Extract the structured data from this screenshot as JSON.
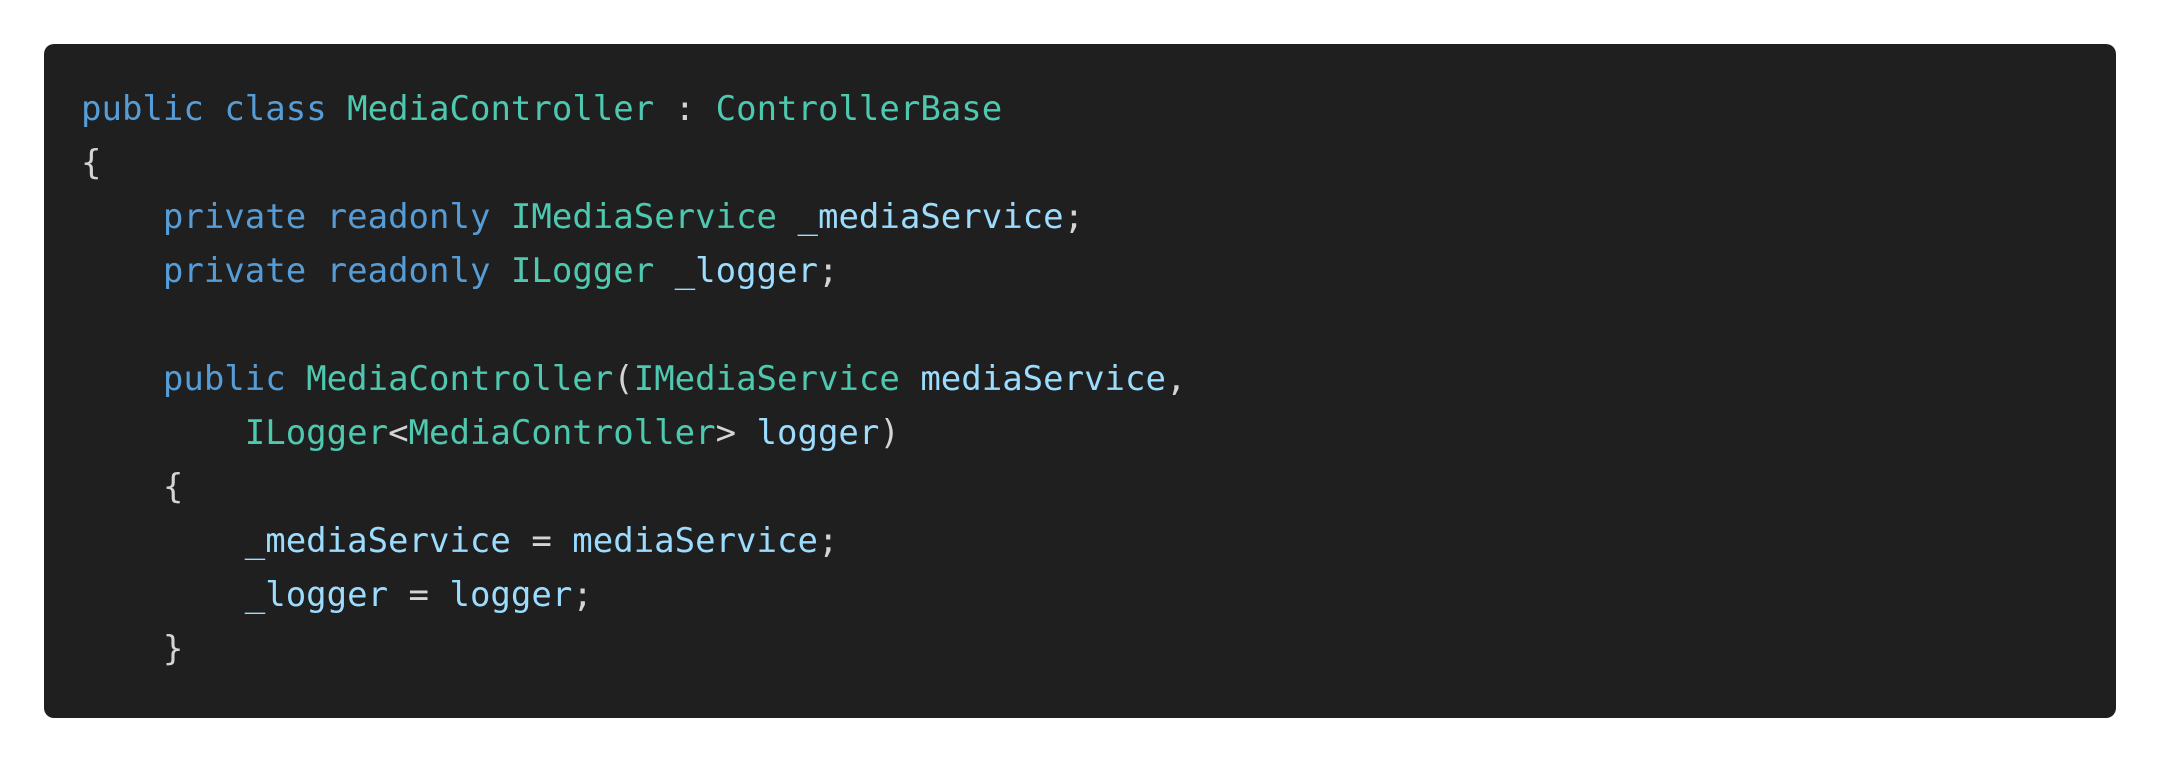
{
  "code_block": {
    "language": "C#",
    "theme_colors": {
      "background": "#1f1f1f",
      "keyword": "#569cd6",
      "type": "#4ec9b0",
      "identifier": "#9cdcfe",
      "punctuation": "#d4d4d4"
    },
    "lines": [
      [
        {
          "t": "public",
          "c": "kw"
        },
        {
          "t": " ",
          "c": "pun"
        },
        {
          "t": "class",
          "c": "kw"
        },
        {
          "t": " ",
          "c": "pun"
        },
        {
          "t": "MediaController",
          "c": "typ"
        },
        {
          "t": " : ",
          "c": "pun"
        },
        {
          "t": "ControllerBase",
          "c": "typ"
        }
      ],
      [
        {
          "t": "{",
          "c": "pun"
        }
      ],
      [
        {
          "t": "    ",
          "c": "pun"
        },
        {
          "t": "private",
          "c": "kw"
        },
        {
          "t": " ",
          "c": "pun"
        },
        {
          "t": "readonly",
          "c": "kw"
        },
        {
          "t": " ",
          "c": "pun"
        },
        {
          "t": "IMediaService",
          "c": "typ"
        },
        {
          "t": " ",
          "c": "pun"
        },
        {
          "t": "_mediaService",
          "c": "id"
        },
        {
          "t": ";",
          "c": "pun"
        }
      ],
      [
        {
          "t": "    ",
          "c": "pun"
        },
        {
          "t": "private",
          "c": "kw"
        },
        {
          "t": " ",
          "c": "pun"
        },
        {
          "t": "readonly",
          "c": "kw"
        },
        {
          "t": " ",
          "c": "pun"
        },
        {
          "t": "ILogger",
          "c": "typ"
        },
        {
          "t": " ",
          "c": "pun"
        },
        {
          "t": "_logger",
          "c": "id"
        },
        {
          "t": ";",
          "c": "pun"
        }
      ],
      [],
      [
        {
          "t": "    ",
          "c": "pun"
        },
        {
          "t": "public",
          "c": "kw"
        },
        {
          "t": " ",
          "c": "pun"
        },
        {
          "t": "MediaController",
          "c": "typ"
        },
        {
          "t": "(",
          "c": "pun"
        },
        {
          "t": "IMediaService",
          "c": "typ"
        },
        {
          "t": " ",
          "c": "pun"
        },
        {
          "t": "mediaService",
          "c": "id"
        },
        {
          "t": ",",
          "c": "pun"
        }
      ],
      [
        {
          "t": "        ",
          "c": "pun"
        },
        {
          "t": "ILogger",
          "c": "typ"
        },
        {
          "t": "<",
          "c": "pun"
        },
        {
          "t": "MediaController",
          "c": "typ"
        },
        {
          "t": "> ",
          "c": "pun"
        },
        {
          "t": "logger",
          "c": "id"
        },
        {
          "t": ")",
          "c": "pun"
        }
      ],
      [
        {
          "t": "    ",
          "c": "pun"
        },
        {
          "t": "{",
          "c": "pun"
        }
      ],
      [
        {
          "t": "        ",
          "c": "pun"
        },
        {
          "t": "_mediaService",
          "c": "id"
        },
        {
          "t": " = ",
          "c": "pun"
        },
        {
          "t": "mediaService",
          "c": "id"
        },
        {
          "t": ";",
          "c": "pun"
        }
      ],
      [
        {
          "t": "        ",
          "c": "pun"
        },
        {
          "t": "_logger",
          "c": "id"
        },
        {
          "t": " = ",
          "c": "pun"
        },
        {
          "t": "logger",
          "c": "id"
        },
        {
          "t": ";",
          "c": "pun"
        }
      ],
      [
        {
          "t": "    ",
          "c": "pun"
        },
        {
          "t": "}",
          "c": "pun"
        }
      ]
    ]
  }
}
